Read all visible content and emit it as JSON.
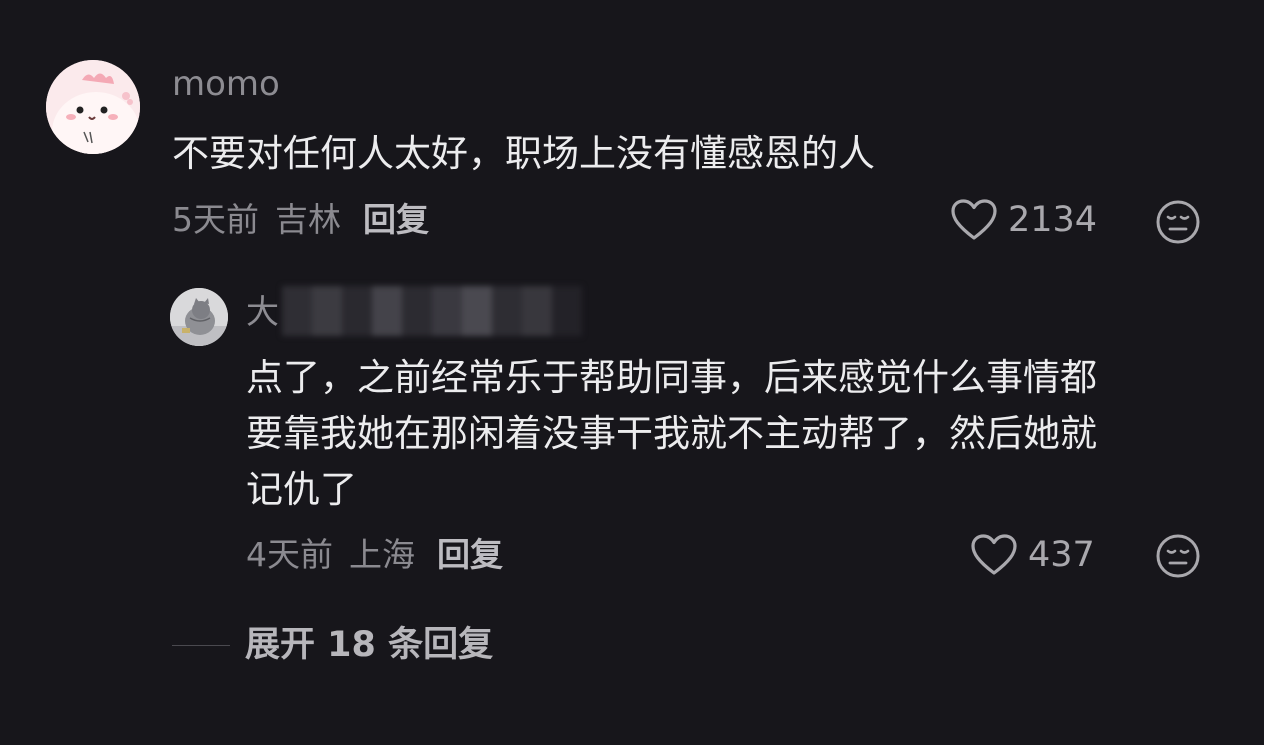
{
  "comment": {
    "username": "momo",
    "text": "不要对任何人太好，职场上没有懂感恩的人",
    "time": "5天前",
    "location": "吉林",
    "reply_label": "回复",
    "like_count": "2134",
    "like_icon": "heart-outline-icon",
    "emoji_icon": "neutral-face-icon"
  },
  "reply": {
    "username_visible": "大",
    "text_lines": [
      "点了，之前经常乐于帮助同事，后来感觉什么事情都",
      "要靠我她在那闲着没事干我就不主动帮了，然后她就",
      "记仇了"
    ],
    "time": "4天前",
    "location": "上海",
    "reply_label": "回复",
    "like_count": "437",
    "like_icon": "heart-outline-icon",
    "emoji_icon": "neutral-face-icon"
  },
  "expand": {
    "label": "展开 18 条回复"
  },
  "colors": {
    "background": "#17161b",
    "primary_text": "#ececee",
    "secondary_text": "#8b8a90",
    "reply_label": "#bdbcc1"
  }
}
